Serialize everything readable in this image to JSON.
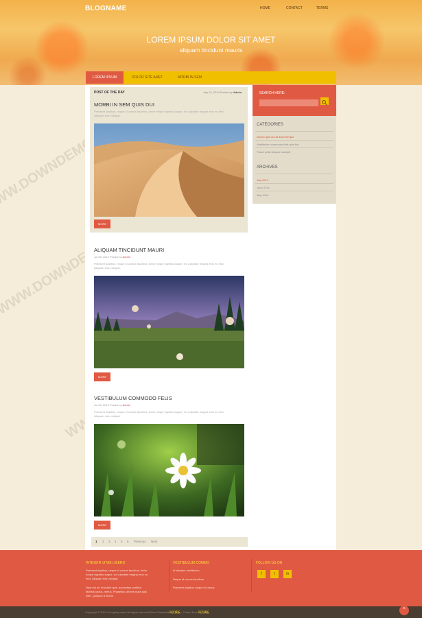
{
  "header": {
    "logo": "BLOGNAME",
    "nav": [
      "HOME",
      "CONTACT",
      "TERMS"
    ],
    "hero_title": "LOREM IPSUM DOLOR SIT AMET",
    "hero_subtitle": "aliquam tincidunt mauris"
  },
  "tabs": [
    "LOREM IPSUM",
    "DOLOR SITE AMET",
    "MORBI IN SEM"
  ],
  "post_of_day": {
    "label": "POST OF THE DAY",
    "meta_date": "July 24, 2014 Posted by",
    "meta_author": "Admin",
    "title": "MORBI IN SEM QUIS DUI",
    "excerpt": "Praesent dapibus, neque id cursus faucibus, tortor neque egestas augue, eu vulputate magna eros eu erat. Aliquam erat volutpat.",
    "more": "MORE"
  },
  "posts": [
    {
      "title": "ALIQUAM TINCIDUNT MAURI",
      "meta_date": "Jul 25, 2014 Posted by",
      "meta_author": "Admin",
      "excerpt": "Praesent dapibus, neque id cursus faucibus, tortor neque egestas augue, eu vulputate magna eros eu erat. Aliquam erat volutpat.",
      "more": "MORE"
    },
    {
      "title": "VESTIBULUM COMMODO FELIS",
      "meta_date": "Jul 26, 2014 Posted by",
      "meta_author": "Admin",
      "excerpt": "Praesent dapibus, neque id cursus faucibus, tortor neque egestas augue, eu vulputate magna eros eu erat. Aliquam erat volutpat.",
      "more": "MORE"
    }
  ],
  "pagination": [
    "1",
    "2",
    "3",
    "4",
    "5",
    "6",
    "Previous",
    "Next"
  ],
  "sidebar": {
    "search_label": "SEARCH HERE:",
    "categories_title": "CATEGORIES",
    "categories": [
      "Donec quis dui at dolor tempor",
      "Vestibulum commodo felis quis tort",
      "Fusce pellentesque suscipit"
    ],
    "archives_title": "ARCHIVES",
    "archives": [
      "July 2014",
      "June 2014",
      "May 2014"
    ]
  },
  "footer": {
    "col1_title": "INTEGER VITAE LIBERO",
    "col1_text1": "Praesent dapibus, neque id cursus faucibus, tortor neque egestas augue, eu vulputate magna eros eu erat. Aliquam erat volutpat.",
    "col1_text2": "Nam dui mi, tincidunt quis, accumsan porttitor, facilisis luctus, metus. Phasellus ultrices nulla quis nibh. Quisque a lectus.",
    "col2_title": "VESTIBULUM COMMO",
    "col2_links": [
      "Id aliquam vestibulum",
      "Neque id cursus faucibus",
      "Praesent dapibus neque id cursus"
    ],
    "col3_title": "FOLLOW US ON",
    "social": [
      "f",
      "t",
      "in"
    ],
    "copyright": "Copyright © 2014 Company name All rights reserved.More Templates",
    "copyright_link1": "网页模板",
    "copyright_mid": " - Collect from ",
    "copyright_link2": "网页模板"
  },
  "watermark": "WWW.DOWNDEMO.COM",
  "colors": {
    "accent": "#e05a43",
    "yellow": "#f0c000",
    "cream": "#f5ecd9",
    "dark": "#4a3d32"
  }
}
